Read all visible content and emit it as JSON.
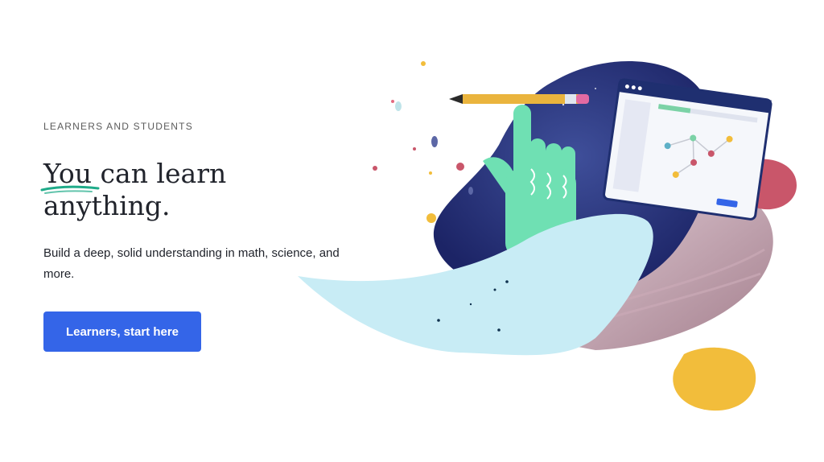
{
  "hero": {
    "eyebrow": "LEARNERS AND STUDENTS",
    "headline_part1": "You",
    "headline_part2": " can learn anything.",
    "subtitle": "Build a deep, solid understanding in math, science, and more.",
    "cta_label": "Learners, start here"
  },
  "colors": {
    "primary_button": "#3465e8",
    "heading_text": "#21242c",
    "underline_accent": "#1fab89"
  },
  "illustration": {
    "icons": [
      "pencil-icon",
      "hand-icon",
      "browser-window-icon",
      "molecule-icon"
    ]
  }
}
